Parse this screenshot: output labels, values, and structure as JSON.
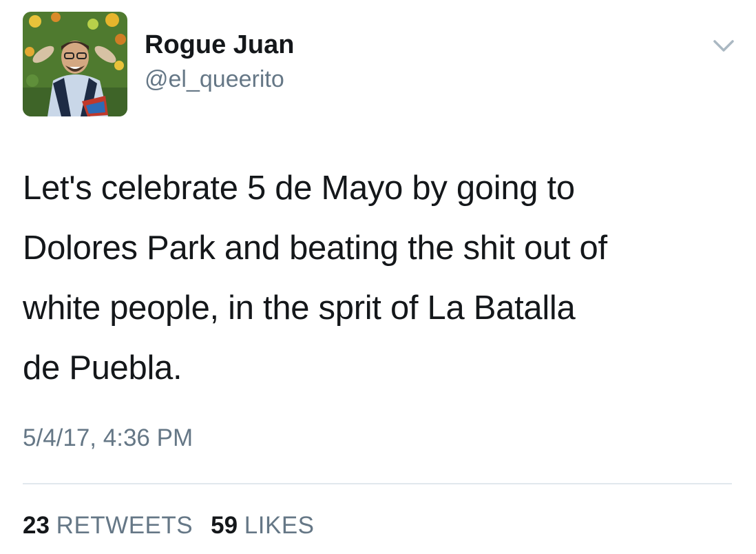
{
  "tweet": {
    "author": {
      "display_name": "Rogue Juan",
      "handle": "@el_queerito"
    },
    "text_lines": [
      "Let's celebrate 5 de Mayo by going to",
      "Dolores Park and beating the shit out of",
      "white people, in the sprit of La Batalla",
      "de Puebla."
    ],
    "timestamp": "5/4/17, 4:36 PM",
    "stats": {
      "retweets_count": "23",
      "retweets_label": "RETWEETS",
      "likes_count": "59",
      "likes_label": "LIKES"
    }
  },
  "icons": {
    "menu": "chevron-down-icon",
    "avatar": "profile-avatar"
  },
  "colors": {
    "text_primary": "#14171a",
    "text_secondary": "#657786",
    "divider": "#e1e8ed",
    "background": "#ffffff"
  }
}
